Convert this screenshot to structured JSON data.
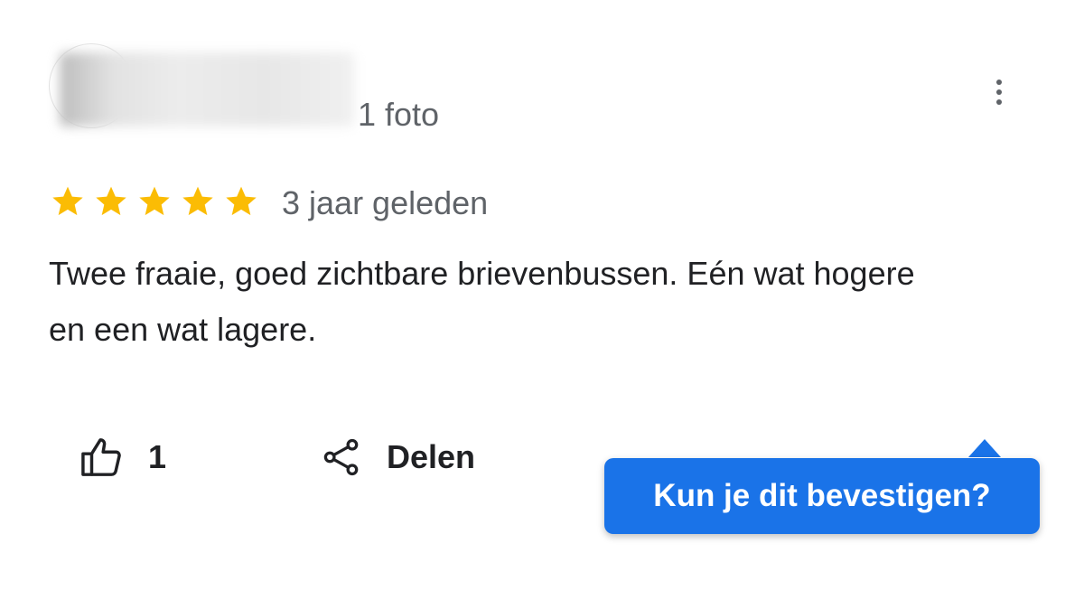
{
  "review": {
    "photo_count": "1 foto",
    "rating": 5,
    "star_color": "#fbbc04",
    "age": "3 jaar geleden",
    "text": "Twee fraaie, goed zichtbare brievenbussen. Eén wat hogere en een wat lagere."
  },
  "actions": {
    "like_icon": "thumbs-up-icon",
    "like_count": "1",
    "share_icon": "share-icon",
    "share_label": "Delen",
    "more_icon": "more-vert-icon"
  },
  "tooltip": {
    "label": "Kun je dit bevestigen?",
    "color": "#1a73e8"
  }
}
